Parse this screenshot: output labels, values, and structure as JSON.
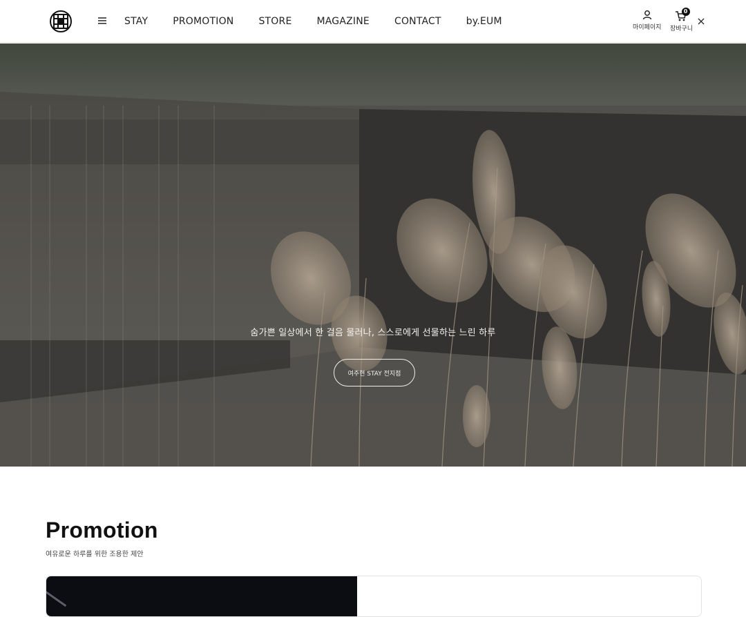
{
  "header": {
    "logo_icon": "eum-monogram-logo",
    "menu_icon": "hamburger-icon",
    "nav": [
      {
        "label": "STAY"
      },
      {
        "label": "PROMOTION"
      },
      {
        "label": "STORE"
      },
      {
        "label": "MAGAZINE"
      },
      {
        "label": "CONTACT"
      },
      {
        "label": "by.EUM"
      }
    ],
    "mypage_label": "마이페이지",
    "cart_label": "장바구니",
    "cart_count": "0"
  },
  "hero": {
    "tagline": "숨가쁜 일상에서 한 걸음 물러나, 스스로에게 선물하는 느린 하루",
    "button_label": "여주현 STAY 전지점",
    "image_subject": "pampas-grass"
  },
  "promotion": {
    "title": "Promotion",
    "subtitle": "여유로운 하루를 위한 조용한 제안"
  },
  "colors": {
    "accent_dark": "#111111",
    "hero_overlay": "#5a5853",
    "text_light": "#f3f1ee"
  }
}
